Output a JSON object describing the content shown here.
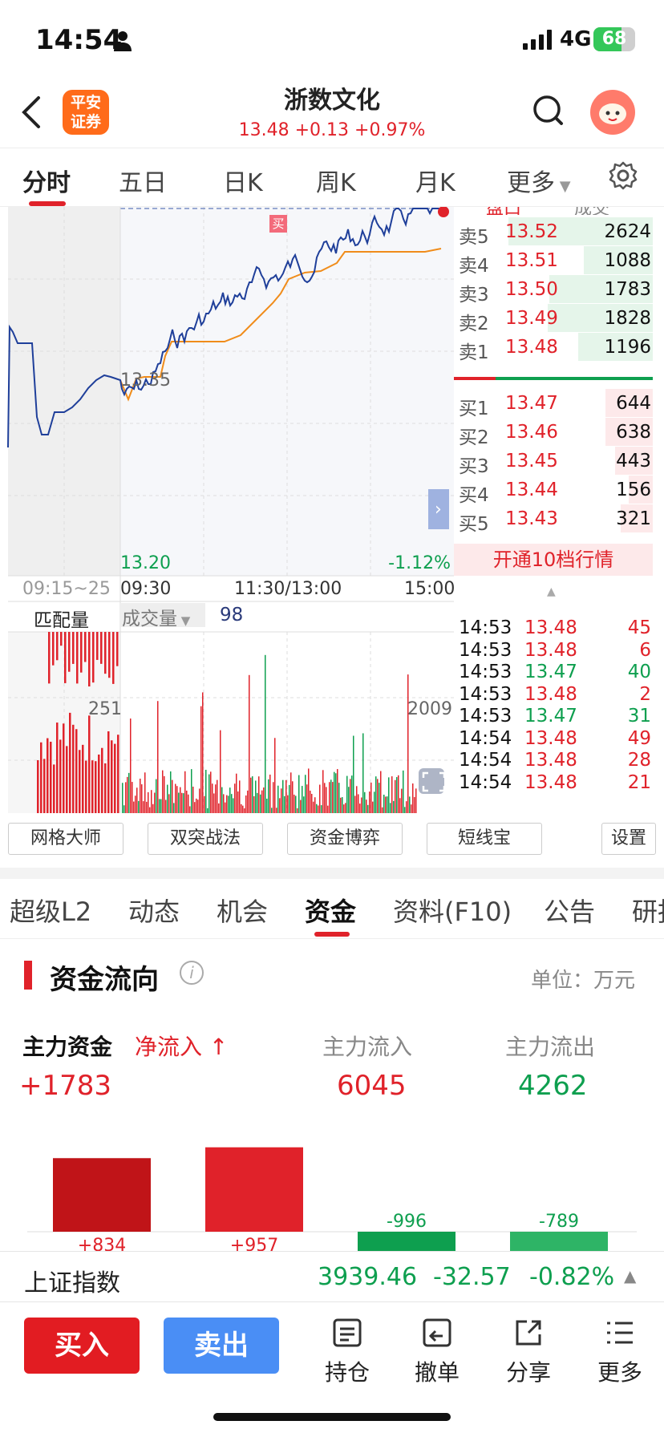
{
  "status_bar": {
    "time": "14:54",
    "network": "4G",
    "battery": "68",
    "battery_level": 0.68
  },
  "header": {
    "broker_logo": "平安证券",
    "stock_name": "浙数文化",
    "quote": "13.48 +0.13 +0.97%"
  },
  "chart_tabs": [
    {
      "label": "分时"
    },
    {
      "label": "五日"
    },
    {
      "label": "日K"
    },
    {
      "label": "周K"
    },
    {
      "label": "月K"
    },
    {
      "label": "更多"
    }
  ],
  "chart": {
    "price_label_mid": "13.35",
    "price_label_low": "13.20",
    "pct_label_low": "-1.12%",
    "buy_marker": "买",
    "time_labels": [
      "09:15~25",
      "09:30",
      "11:30/13:00",
      "15:00"
    ],
    "volume_header": {
      "left": "匹配量",
      "selector": "成交量",
      "value": "98"
    },
    "volume_labels": {
      "left": "251",
      "right": "2009"
    },
    "colors": {
      "up": "#e0222a",
      "down": "#0e9f4f",
      "price_line": "#1f3f9a",
      "avg_line": "#f08c1a"
    }
  },
  "order_book": {
    "header": [
      "盘口",
      "成交"
    ],
    "asks": [
      {
        "label": "卖5",
        "price": "13.52",
        "vol": "2624"
      },
      {
        "label": "卖4",
        "price": "13.51",
        "vol": "1088"
      },
      {
        "label": "卖3",
        "price": "13.50",
        "vol": "1783"
      },
      {
        "label": "卖2",
        "price": "13.49",
        "vol": "1828"
      },
      {
        "label": "卖1",
        "price": "13.48",
        "vol": "1196"
      }
    ],
    "bids": [
      {
        "label": "买1",
        "price": "13.47",
        "vol": "644"
      },
      {
        "label": "买2",
        "price": "13.46",
        "vol": "638"
      },
      {
        "label": "买3",
        "price": "13.45",
        "vol": "443"
      },
      {
        "label": "买4",
        "price": "13.44",
        "vol": "156"
      },
      {
        "label": "买5",
        "price": "13.43",
        "vol": "321"
      }
    ],
    "upgrade_label": "开通10档行情"
  },
  "ticks": [
    {
      "time": "14:53",
      "price": "13.48",
      "vol": "45",
      "dir": "up"
    },
    {
      "time": "14:53",
      "price": "13.48",
      "vol": "6",
      "dir": "up"
    },
    {
      "time": "14:53",
      "price": "13.47",
      "vol": "40",
      "dir": "down"
    },
    {
      "time": "14:53",
      "price": "13.48",
      "vol": "2",
      "dir": "up"
    },
    {
      "time": "14:53",
      "price": "13.47",
      "vol": "31",
      "dir": "down"
    },
    {
      "time": "14:54",
      "price": "13.48",
      "vol": "49",
      "dir": "up"
    },
    {
      "time": "14:54",
      "price": "13.48",
      "vol": "28",
      "dir": "up"
    },
    {
      "time": "14:54",
      "price": "13.48",
      "vol": "21",
      "dir": "up"
    }
  ],
  "tools": [
    "网格大师",
    "双突战法",
    "资金博弈",
    "短线宝",
    "设置"
  ],
  "info_tabs": [
    "超级L2",
    "动态",
    "机会",
    "资金",
    "资料(F10)",
    "公告",
    "研报"
  ],
  "fund_flow": {
    "title": "资金流向",
    "unit": "单位：万元",
    "main_label": "主力资金",
    "net_label": "净流入 ↑",
    "main_value": "+1783",
    "inflow_label": "主力流入",
    "inflow_value": "6045",
    "outflow_label": "主力流出",
    "outflow_value": "4262",
    "bars": [
      {
        "value": 834,
        "label": "+834"
      },
      {
        "value": 957,
        "label": "+957"
      },
      {
        "value": -996,
        "label": "-996"
      },
      {
        "value": -789,
        "label": "-789"
      }
    ]
  },
  "index_bar": {
    "name": "上证指数",
    "value": "3939.46",
    "change": "-32.57",
    "pct": "-0.82%"
  },
  "bottom_nav": {
    "buy": "买入",
    "sell": "卖出",
    "items": [
      {
        "label": "持仓"
      },
      {
        "label": "撤单"
      },
      {
        "label": "分享"
      },
      {
        "label": "更多"
      }
    ]
  }
}
